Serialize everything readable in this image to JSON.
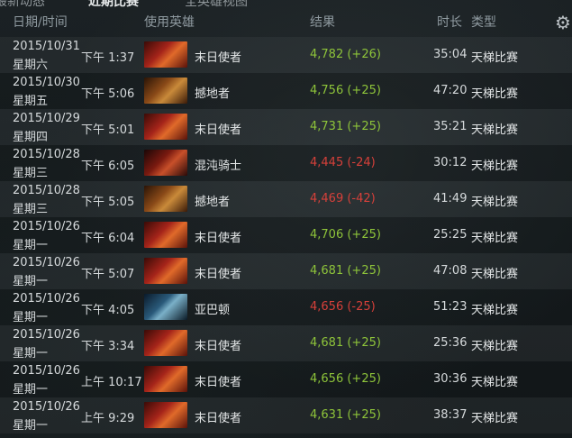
{
  "top_tabs": [
    {
      "label": "最新动态"
    },
    {
      "label": "近期比赛"
    },
    {
      "label": "全英雄视图"
    }
  ],
  "headers": {
    "date_time": "日期/时间",
    "hero": "使用英雄",
    "result": "结果",
    "duration": "时长",
    "type": "类型"
  },
  "icons": {
    "settings": "gear-icon"
  },
  "colors": {
    "win": "#8ec43a",
    "loss": "#d6403a"
  },
  "matches": [
    {
      "date": "2015/10/31",
      "weekday": "星期六",
      "time": "下午 1:37",
      "hero": "末日使者",
      "portrait": "doom",
      "result": "4,782 (+26)",
      "outcome": "win",
      "duration": "35:04",
      "type": "天梯比赛"
    },
    {
      "date": "2015/10/30",
      "weekday": "星期五",
      "time": "下午 5:06",
      "hero": "撼地者",
      "portrait": "earth",
      "result": "4,756 (+25)",
      "outcome": "win",
      "duration": "47:20",
      "type": "天梯比赛"
    },
    {
      "date": "2015/10/29",
      "weekday": "星期四",
      "time": "下午 5:01",
      "hero": "末日使者",
      "portrait": "doom",
      "result": "4,731 (+25)",
      "outcome": "win",
      "duration": "35:21",
      "type": "天梯比赛"
    },
    {
      "date": "2015/10/28",
      "weekday": "星期三",
      "time": "下午 6:05",
      "hero": "混沌骑士",
      "portrait": "chaos",
      "result": "4,445 (-24)",
      "outcome": "loss",
      "duration": "30:12",
      "type": "天梯比赛"
    },
    {
      "date": "2015/10/28",
      "weekday": "星期三",
      "time": "下午 5:05",
      "hero": "撼地者",
      "portrait": "earth",
      "result": "4,469 (-42)",
      "outcome": "loss",
      "duration": "41:49",
      "type": "天梯比赛"
    },
    {
      "date": "2015/10/26",
      "weekday": "星期一",
      "time": "下午 6:04",
      "hero": "末日使者",
      "portrait": "doom",
      "result": "4,706 (+25)",
      "outcome": "win",
      "duration": "25:25",
      "type": "天梯比赛"
    },
    {
      "date": "2015/10/26",
      "weekday": "星期一",
      "time": "下午 5:07",
      "hero": "末日使者",
      "portrait": "doom",
      "result": "4,681 (+25)",
      "outcome": "win",
      "duration": "47:08",
      "type": "天梯比赛"
    },
    {
      "date": "2015/10/26",
      "weekday": "星期一",
      "time": "下午 4:05",
      "hero": "亚巴顿",
      "portrait": "abaddon",
      "result": "4,656 (-25)",
      "outcome": "loss",
      "duration": "51:23",
      "type": "天梯比赛"
    },
    {
      "date": "2015/10/26",
      "weekday": "星期一",
      "time": "下午 3:34",
      "hero": "末日使者",
      "portrait": "doom",
      "result": "4,681 (+25)",
      "outcome": "win",
      "duration": "25:36",
      "type": "天梯比赛"
    },
    {
      "date": "2015/10/26",
      "weekday": "星期一",
      "time": "上午 10:17",
      "hero": "末日使者",
      "portrait": "doom",
      "result": "4,656 (+25)",
      "outcome": "win",
      "duration": "30:36",
      "type": "天梯比赛"
    },
    {
      "date": "2015/10/26",
      "weekday": "星期一",
      "time": "上午 9:29",
      "hero": "末日使者",
      "portrait": "doom",
      "result": "4,631 (+25)",
      "outcome": "win",
      "duration": "38:37",
      "type": "天梯比赛"
    }
  ]
}
